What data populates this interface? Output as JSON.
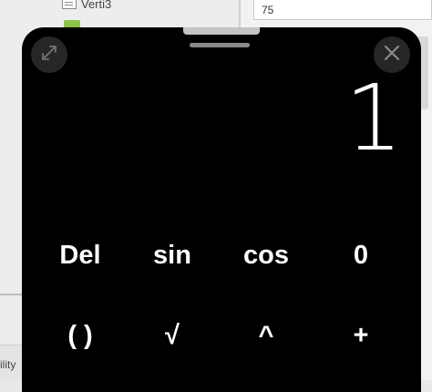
{
  "background": {
    "tree_item_label": "Verti3",
    "input_value": "75",
    "bottom_label": "ility"
  },
  "calculator": {
    "display_value": "1",
    "keys_row1": [
      "Del",
      "sin",
      "cos",
      "0"
    ],
    "keys_row2": [
      "( )",
      "√",
      "^",
      "+"
    ]
  },
  "colors": {
    "calc_background": "#000000",
    "key_text": "#ffffff",
    "circle_button": "#262626"
  },
  "icons": {
    "expand": "expand-icon",
    "close": "close-icon"
  }
}
